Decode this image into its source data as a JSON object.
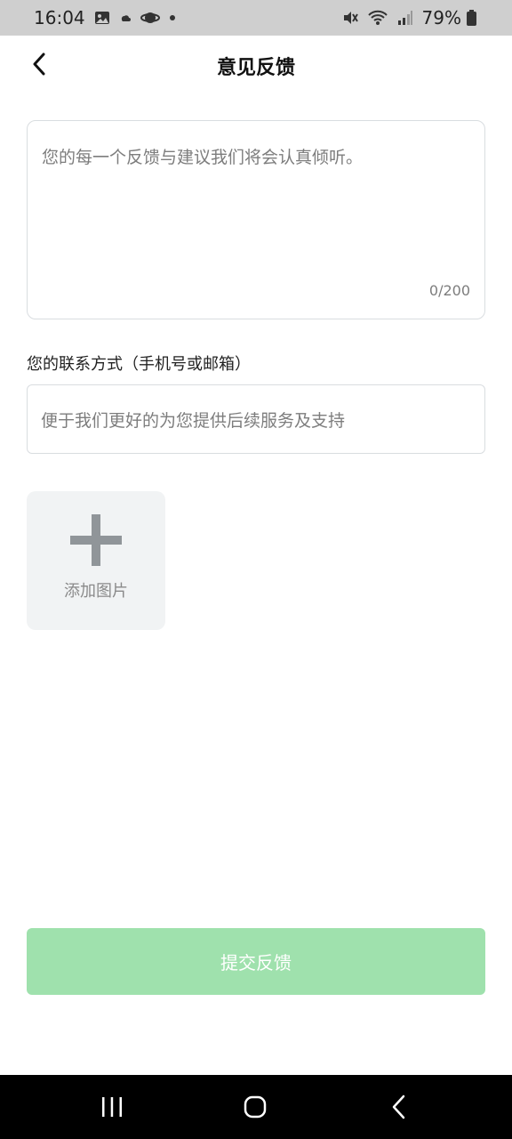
{
  "status_bar": {
    "time": "16:04",
    "battery_percent": "79%",
    "icons": [
      "image-icon",
      "cloud-icon",
      "planet-icon",
      "dot-icon",
      "mute-icon",
      "wifi-icon",
      "signal-icon",
      "battery-icon"
    ]
  },
  "header": {
    "title": "意见反馈",
    "back_icon": "chevron-left-icon"
  },
  "feedback": {
    "placeholder": "您的每一个反馈与建议我们将会认真倾听。",
    "value": "",
    "char_count": "0/200"
  },
  "contact": {
    "label": "您的联系方式（手机号或邮箱）",
    "placeholder": "便于我们更好的为您提供后续服务及支持",
    "value": ""
  },
  "add_image": {
    "label": "添加图片",
    "icon": "plus-icon"
  },
  "submit": {
    "label": "提交反馈"
  },
  "nav_bar": {
    "icons": [
      "recent-apps-icon",
      "home-icon",
      "back-icon"
    ]
  },
  "colors": {
    "accent": "#9fe1ad",
    "border": "#d9dde0",
    "placeholder": "#7d7d7d",
    "status_bar_bg": "#cfcfcf",
    "nav_bar_bg": "#000000"
  }
}
